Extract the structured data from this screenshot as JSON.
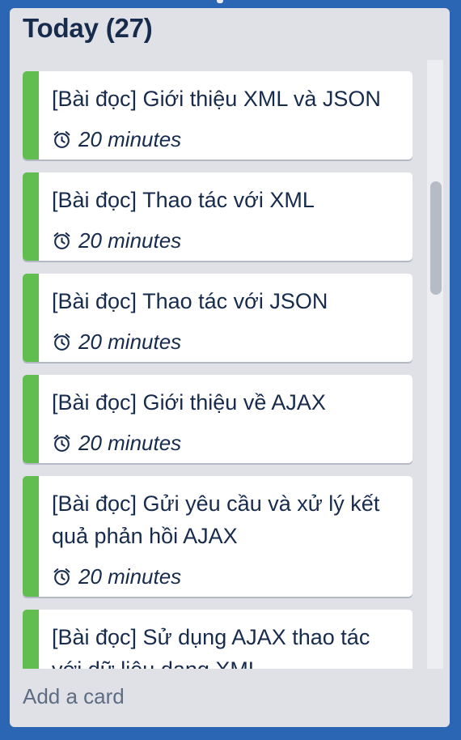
{
  "list": {
    "title": "Today (27)",
    "cards": [
      {
        "title": "[Bài đọc] Giới thiệu XML và JSON",
        "time": "20 minutes",
        "label_color": "#61bd4f"
      },
      {
        "title": "[Bài đọc] Thao tác với XML",
        "time": "20 minutes",
        "label_color": "#61bd4f"
      },
      {
        "title": "[Bài đọc] Thao tác với JSON",
        "time": "20 minutes",
        "label_color": "#61bd4f"
      },
      {
        "title": "[Bài đọc] Giới thiệu về AJAX",
        "time": "20 minutes",
        "label_color": "#61bd4f"
      },
      {
        "title": "[Bài đọc] Gửi yêu cầu và xử lý kết quả phản hồi AJAX",
        "time": "20 minutes",
        "label_color": "#61bd4f"
      },
      {
        "title": "[Bài đọc] Sử dụng AJAX thao tác với dữ liệu dạng XML",
        "time": "",
        "label_color": "#61bd4f"
      }
    ],
    "add_card_label": "Add a card"
  },
  "icons": {
    "card_time": "alarm-clock-icon"
  },
  "colors": {
    "board_background": "#2b66b5",
    "list_background": "#dfe1e6",
    "label_green": "#61bd4f",
    "text_primary": "#172b4d",
    "text_muted": "#5e6c84"
  }
}
